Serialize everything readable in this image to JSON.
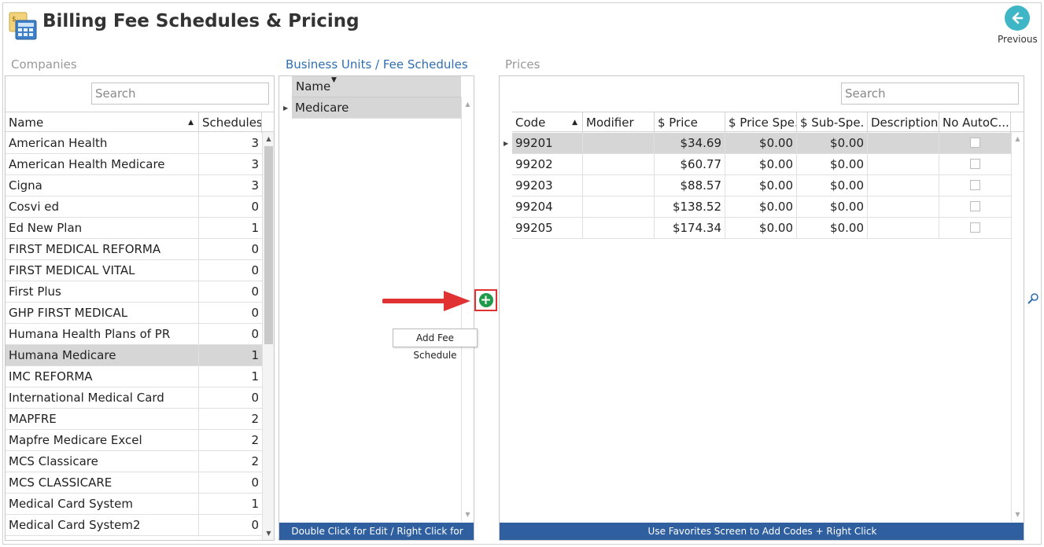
{
  "app": {
    "title": "Billing Fee Schedules & Pricing",
    "icon": "calculator-icon",
    "previous_label": "Previous",
    "previous_icon": "arrow-left-icon",
    "accent_color": "#3fb6c5"
  },
  "companies": {
    "section_label": "Companies",
    "search_placeholder": "Search",
    "columns": [
      "Name",
      "Schedules"
    ],
    "rows": [
      {
        "name": "American Health",
        "schedules": "3"
      },
      {
        "name": "American Health Medicare",
        "schedules": "3"
      },
      {
        "name": "Cigna",
        "schedules": "3"
      },
      {
        "name": "Cosvi ed",
        "schedules": "0"
      },
      {
        "name": "Ed New Plan",
        "schedules": "1"
      },
      {
        "name": "FIRST MEDICAL REFORMA",
        "schedules": "0"
      },
      {
        "name": "FIRST MEDICAL VITAL",
        "schedules": "0"
      },
      {
        "name": "First Plus",
        "schedules": "0"
      },
      {
        "name": "GHP FIRST MEDICAL",
        "schedules": "0"
      },
      {
        "name": "Humana Health Plans of PR",
        "schedules": "0"
      },
      {
        "name": "Humana Medicare",
        "schedules": "1"
      },
      {
        "name": "IMC REFORMA",
        "schedules": "1"
      },
      {
        "name": "International Medical Card",
        "schedules": "0"
      },
      {
        "name": "MAPFRE",
        "schedules": "2"
      },
      {
        "name": "Mapfre Medicare Excel",
        "schedules": "2"
      },
      {
        "name": "MCS Classicare",
        "schedules": "2"
      },
      {
        "name": "MCS CLASSICARE",
        "schedules": "0"
      },
      {
        "name": "Medical Card System",
        "schedules": "1"
      },
      {
        "name": "Medical Card System2",
        "schedules": "0"
      }
    ],
    "selected_index": 10
  },
  "fee_schedules": {
    "section_label": "Business Units / Fee Schedules",
    "column": "Name",
    "rows": [
      {
        "name": "Medicare"
      }
    ],
    "footer": "Double Click for Edit / Right Click for Actions",
    "add_tooltip": "Add Fee Schedule"
  },
  "prices": {
    "section_label": "Prices",
    "search_placeholder": "Search",
    "columns": [
      "Code",
      "Modifier",
      "$ Price",
      "$ Price Spe.",
      "$ Sub-Spe.",
      "Description",
      "No AutoC..."
    ],
    "rows": [
      {
        "code": "99201",
        "modifier": "",
        "price": "$34.69",
        "price_spe": "$0.00",
        "sub_spe": "$0.00",
        "description": ""
      },
      {
        "code": "99202",
        "modifier": "",
        "price": "$60.77",
        "price_spe": "$0.00",
        "sub_spe": "$0.00",
        "description": ""
      },
      {
        "code": "99203",
        "modifier": "",
        "price": "$88.57",
        "price_spe": "$0.00",
        "sub_spe": "$0.00",
        "description": ""
      },
      {
        "code": "99204",
        "modifier": "",
        "price": "$138.52",
        "price_spe": "$0.00",
        "sub_spe": "$0.00",
        "description": ""
      },
      {
        "code": "99205",
        "modifier": "",
        "price": "$174.34",
        "price_spe": "$0.00",
        "sub_spe": "$0.00",
        "description": ""
      }
    ],
    "footer": "Use Favorites Screen to Add Codes + Right Click"
  },
  "colors": {
    "footer_bar": "#2f5f9e",
    "selection": "#d6d6d6",
    "add_button": "#1f9a4a",
    "highlight": "#e03232"
  }
}
